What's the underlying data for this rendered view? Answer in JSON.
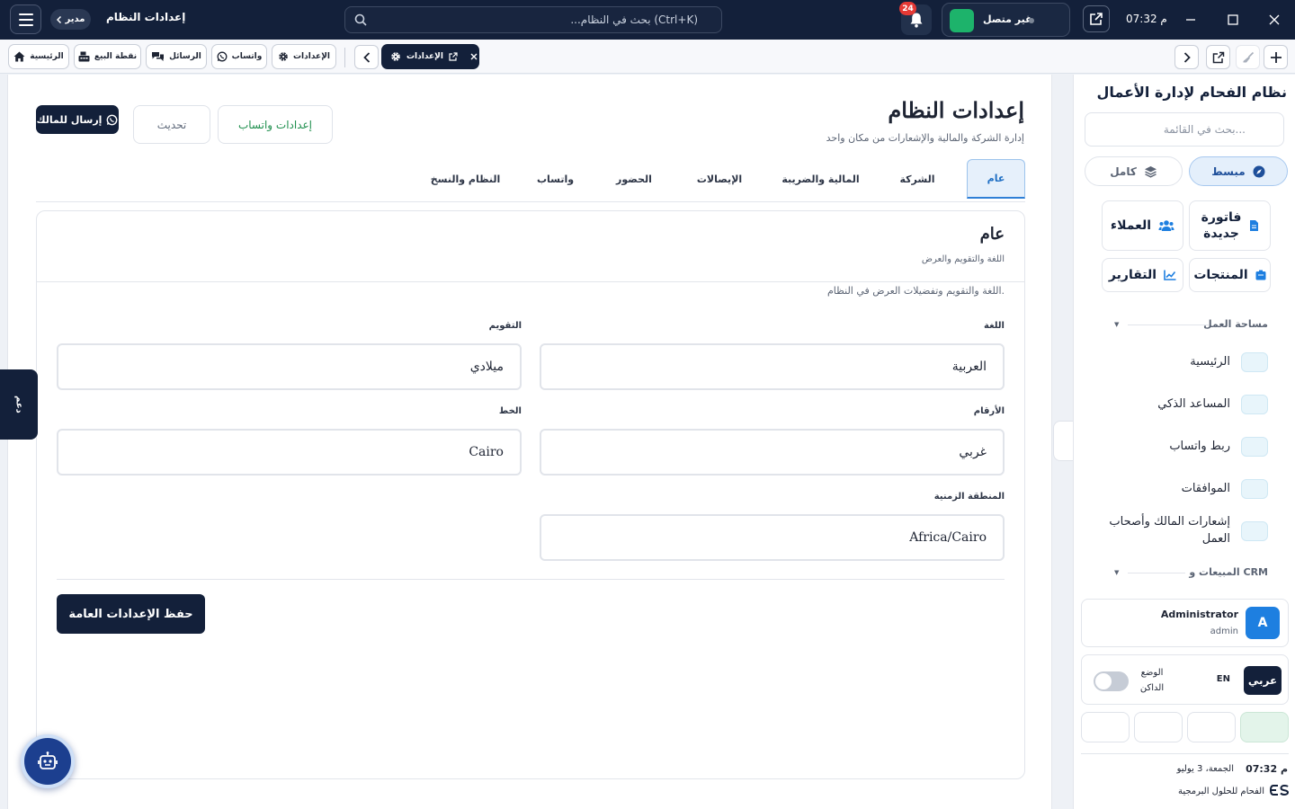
{
  "titlebar": {
    "menu_icon": "hamburger-icon",
    "role_label": "مدير",
    "app_title": "إعدادات النظام",
    "search_placeholder": "...بحث في النظام (Ctrl+K)",
    "notifications_count": "24",
    "connection_status": "غير متصل",
    "clock": "07:32 م"
  },
  "toolbar": {
    "home": "الرئيسية",
    "pos": "نقطة البيع",
    "messages": "الرسائل",
    "whatsapp": "واتساب",
    "settings": "الإعدادات",
    "active_tab": "الإعدادات"
  },
  "header": {
    "title": "إعدادات النظام",
    "subtitle": "إدارة الشركة والمالية والإشعارات من مكان واحد",
    "send_owner": "إرسال للمالك",
    "refresh": "تحديث",
    "whatsapp_settings": "إعدادات واتساب"
  },
  "tabs": [
    {
      "label": "عام"
    },
    {
      "label": "الشركة"
    },
    {
      "label": "المالية والضريبة"
    },
    {
      "label": "الإيصالات"
    },
    {
      "label": "الحضور"
    },
    {
      "label": "واتساب"
    },
    {
      "label": "النظام والنسخ"
    }
  ],
  "card": {
    "title": "عام",
    "subtitle": "اللغة والتقويم والعرض",
    "description": "اللغة والتقويم وتفضيلات العرض في النظام."
  },
  "form": {
    "language_label": "اللغة",
    "language_value": "العربية",
    "calendar_label": "التقويم",
    "calendar_value": "ميلادي",
    "digits_label": "الأرقام",
    "digits_value": "غربي",
    "font_label": "الخط",
    "font_value": "Cairo",
    "timezone_label": "المنطقة الزمنية",
    "timezone_value": "Africa/Cairo",
    "save": "حفظ الإعدادات العامة"
  },
  "side_tab": "دعم",
  "sidebar": {
    "title": "نظام الفحام لإدارة الأعمال",
    "search_placeholder": "بحث في القائمة...",
    "mode_simple": "مبسط",
    "mode_full": "كامل",
    "quick": {
      "new_invoice": "فاتورة جديدة",
      "customers": "العملاء",
      "products": "المنتجات",
      "reports": "التقارير"
    },
    "section_workspace": "مساحة العمل",
    "items": [
      {
        "label": "الرئيسية"
      },
      {
        "label": "المساعد الذكي"
      },
      {
        "label": "ربط واتساب"
      },
      {
        "label": "الموافقات"
      },
      {
        "label": "إشعارات المالك وأصحاب العمل"
      }
    ],
    "section_sales": "المبيعات و CRM",
    "user_name": "Administrator",
    "user_role": "admin",
    "avatar_letter": "A",
    "lang_ar": "عربي",
    "lang_en": "EN",
    "dark_mode": "الوضع الداكن",
    "time": "07:32 م",
    "date": "الجمعة، 3 يوليو",
    "brand": "الفحام للحلول البرمجية"
  },
  "colors": {
    "primary": "#13203a",
    "accent": "#1f6fc4",
    "success": "#1db36b",
    "danger": "#e53935"
  }
}
